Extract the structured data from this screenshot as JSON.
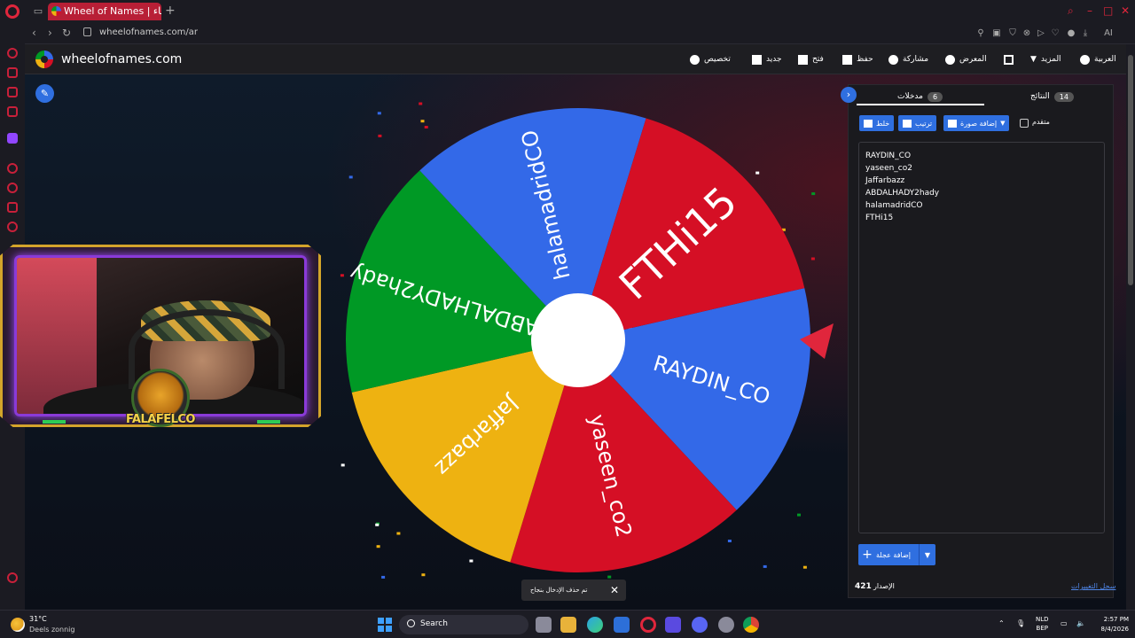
{
  "browser": {
    "tab_title": "Wheel of Names | عجلة الأسماء",
    "url": "wheelofnames.com/ar",
    "ai_label": "AI"
  },
  "site": {
    "brand": "wheelofnames.com",
    "nav": {
      "customize": "تخصيص",
      "new": "جديد",
      "open": "فتح",
      "save": "حفظ",
      "share": "مشاركة",
      "gallery": "المعرض",
      "more": "المزيد",
      "language": "العربية"
    }
  },
  "wheel": {
    "segments": [
      {
        "label": "RAYDIN_CO",
        "color": "#3369e8"
      },
      {
        "label": "yaseen_co2",
        "color": "#d50f25"
      },
      {
        "label": "Jaffarbazz",
        "color": "#eeb211"
      },
      {
        "label": "ABDALHADY2hady",
        "color": "#009925"
      },
      {
        "label": "halamadridCO",
        "color": "#3369e8"
      },
      {
        "label": "FTHi15",
        "color": "#d50f25"
      }
    ],
    "pointer_color": "#e0263c"
  },
  "webcam": {
    "badge_text": "FALAFELCO"
  },
  "panel": {
    "tabs": {
      "entries_label": "مدخلات",
      "entries_count": "6",
      "results_label": "النتائج",
      "results_count": "14"
    },
    "buttons": {
      "shuffle": "خلط",
      "sort": "ترتيب",
      "add_image": "إضافة صورة"
    },
    "advanced_label": "متقدم",
    "entries": [
      "RAYDIN_CO",
      "yaseen_co2",
      "Jaffarbazz",
      "ABDALHADY2hady",
      "halamadridCO",
      "FTHi15"
    ],
    "add_wheel": "إضافة عجلة",
    "version_label": "الإصدار",
    "version_number": "421",
    "changelog": "سجل التغييرات"
  },
  "toast": {
    "message": "تم حذف الإدخال بنجاح"
  },
  "taskbar": {
    "temperature": "31°C",
    "weather": "Deels zonnig",
    "search_placeholder": "Search",
    "lang_line1": "NLD",
    "lang_line2": "BEP",
    "time": "2:57 PM",
    "date": "8/4/2026"
  }
}
